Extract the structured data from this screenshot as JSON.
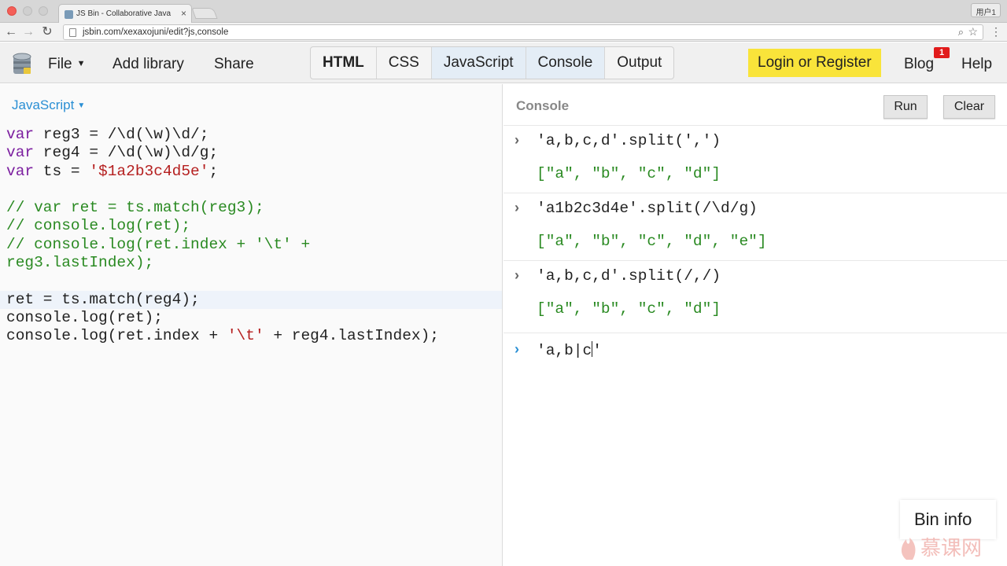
{
  "browser": {
    "tab_title": "JS Bin - Collaborative Java",
    "tab_close": "×",
    "user_badge": "用户1",
    "url": "jsbin.com/xexaxojuni/edit?js,console",
    "back_glyph": "←",
    "forward_glyph": "→",
    "reload_glyph": "↻",
    "zoom_glyph": "⌕",
    "star_glyph": "☆",
    "menu_glyph": "⋮"
  },
  "toolbar": {
    "file_label": "File",
    "file_caret": "▼",
    "add_library_label": "Add library",
    "share_label": "Share",
    "panels": [
      {
        "label": "HTML",
        "bold": true,
        "active": false
      },
      {
        "label": "CSS",
        "bold": false,
        "active": false
      },
      {
        "label": "JavaScript",
        "bold": false,
        "active": true
      },
      {
        "label": "Console",
        "bold": false,
        "active": true
      },
      {
        "label": "Output",
        "bold": false,
        "active": false
      }
    ],
    "login_label": "Login or Register",
    "blog_label": "Blog",
    "blog_badge": "1",
    "help_label": "Help",
    "login_color": "#f9e43a",
    "badge_color": "#e11b1b"
  },
  "editor": {
    "language_label": "JavaScript",
    "language_caret": "▼",
    "lines": [
      [
        {
          "t": "var",
          "c": "kw"
        },
        {
          "t": " reg3 = /\\d(\\w)\\d/;",
          "c": ""
        }
      ],
      [
        {
          "t": "var",
          "c": "kw"
        },
        {
          "t": " reg4 = /\\d(\\w)\\d/g;",
          "c": ""
        }
      ],
      [
        {
          "t": "var",
          "c": "kw"
        },
        {
          "t": " ts = ",
          "c": ""
        },
        {
          "t": "'$1a2b3c4d5e'",
          "c": "str"
        },
        {
          "t": ";",
          "c": ""
        }
      ],
      [
        {
          "t": "",
          "c": ""
        }
      ],
      [
        {
          "t": "// var ret = ts.match(reg3);",
          "c": "cm"
        }
      ],
      [
        {
          "t": "// console.log(ret);",
          "c": "cm"
        }
      ],
      [
        {
          "t": "// console.log(ret.index + '\\t' +",
          "c": "cm"
        }
      ],
      [
        {
          "t": "reg3.lastIndex);",
          "c": "cm"
        }
      ],
      [
        {
          "t": "",
          "c": ""
        }
      ],
      [
        {
          "t": "ret = ts.match(reg4);",
          "c": ""
        }
      ],
      [
        {
          "t": "console.log(ret);",
          "c": ""
        }
      ],
      [
        {
          "t": "console.log(ret.index + ",
          "c": ""
        },
        {
          "t": "'\\t'",
          "c": "str"
        },
        {
          "t": " + reg4.lastIndex);",
          "c": ""
        }
      ]
    ]
  },
  "console": {
    "title": "Console",
    "run_label": "Run",
    "clear_label": "Clear",
    "prompt_glyph": "›",
    "entries": [
      {
        "input": "'a,b,c,d'.split(',')",
        "output": "[\"a\", \"b\", \"c\", \"d\"]"
      },
      {
        "input": "'a1b2c3d4e'.split(/\\d/g)",
        "output": "[\"a\", \"b\", \"c\", \"d\", \"e\"]"
      },
      {
        "input": "'a,b,c,d'.split(/,/)",
        "output": "[\"a\", \"b\", \"c\", \"d\"]"
      }
    ],
    "current_input_before_cursor": "'a,b|c",
    "current_input_after_cursor": "'"
  },
  "bin_info_label": "Bin info",
  "watermark_text": "慕课网"
}
